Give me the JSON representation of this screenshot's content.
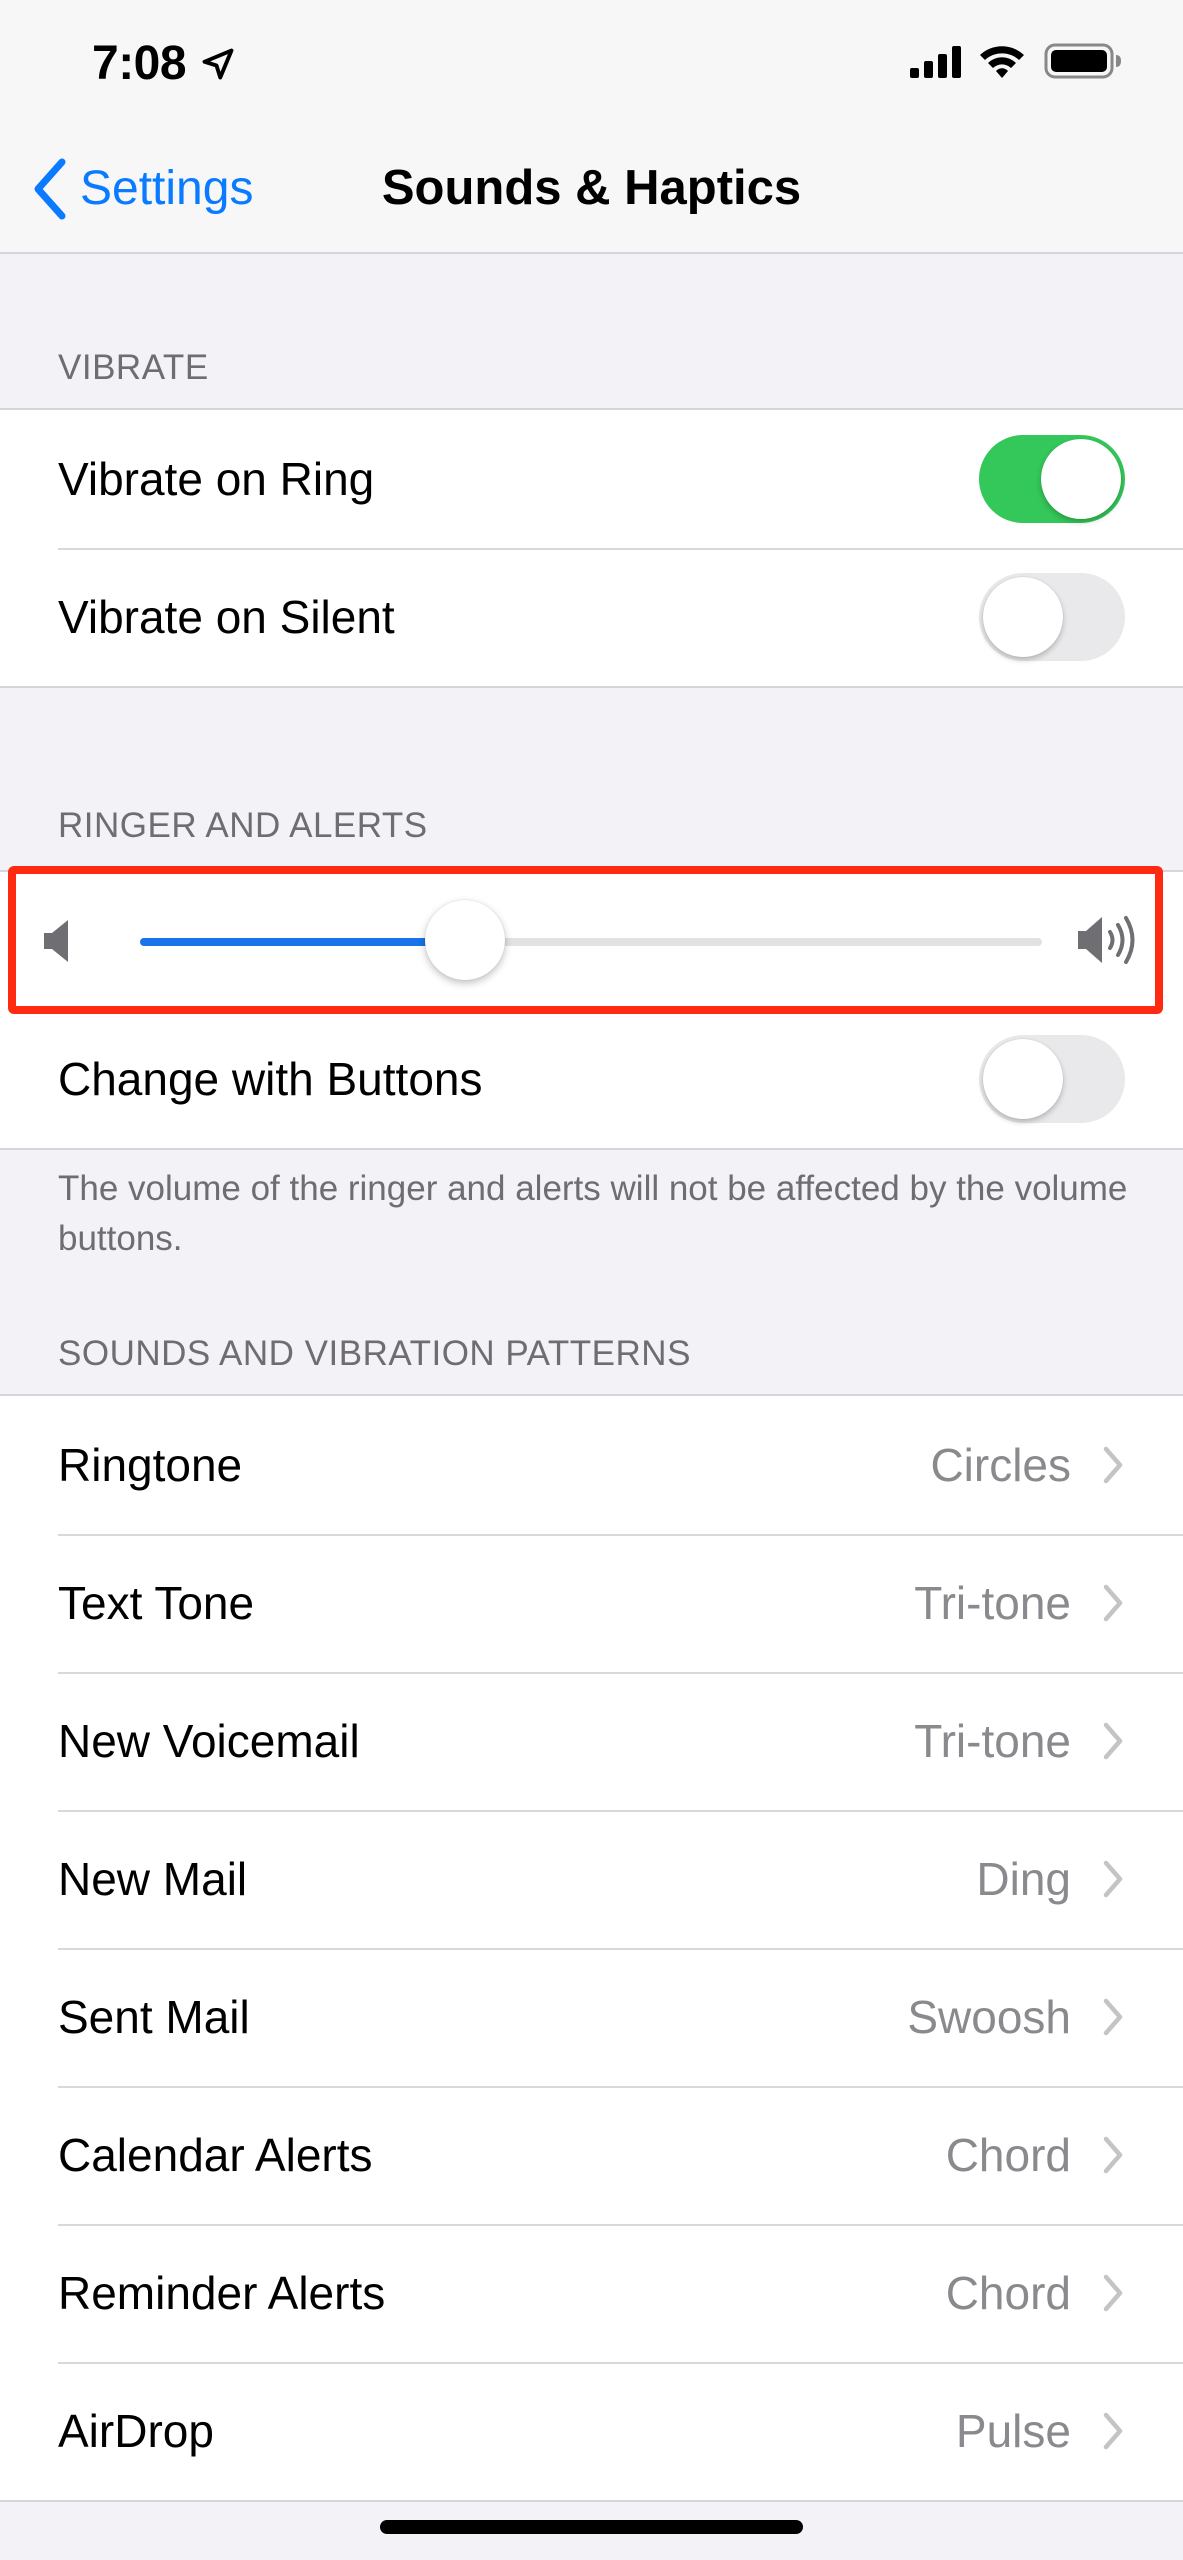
{
  "status_bar": {
    "time": "7:08"
  },
  "nav": {
    "back_label": "Settings",
    "title": "Sounds & Haptics"
  },
  "vibrate": {
    "header": "VIBRATE",
    "rows": [
      {
        "label": "Vibrate on Ring",
        "on": true
      },
      {
        "label": "Vibrate on Silent",
        "on": false
      }
    ]
  },
  "ringer": {
    "header": "RINGER AND ALERTS",
    "volume_fraction": 0.36,
    "change_with_buttons_label": "Change with Buttons",
    "change_with_buttons_on": false,
    "footer_note": "The volume of the ringer and alerts will not be affected by the volume buttons."
  },
  "patterns": {
    "header": "SOUNDS AND VIBRATION PATTERNS",
    "rows": [
      {
        "label": "Ringtone",
        "value": "Circles"
      },
      {
        "label": "Text Tone",
        "value": "Tri-tone"
      },
      {
        "label": "New Voicemail",
        "value": "Tri-tone"
      },
      {
        "label": "New Mail",
        "value": "Ding"
      },
      {
        "label": "Sent Mail",
        "value": "Swoosh"
      },
      {
        "label": "Calendar Alerts",
        "value": "Chord"
      },
      {
        "label": "Reminder Alerts",
        "value": "Chord"
      },
      {
        "label": "AirDrop",
        "value": "Pulse"
      }
    ]
  },
  "colors": {
    "accent": "#0a7aff",
    "toggle_on": "#34c759",
    "slider_fill": "#1a73e8",
    "highlight": "#ff2a12"
  },
  "icons": {
    "location": "location-arrow-icon",
    "signal": "cellular-signal-icon",
    "wifi": "wifi-icon",
    "battery": "battery-icon",
    "back": "chevron-left-icon",
    "volume_low": "speaker-low-icon",
    "volume_high": "speaker-high-icon",
    "disclosure": "chevron-right-icon"
  }
}
